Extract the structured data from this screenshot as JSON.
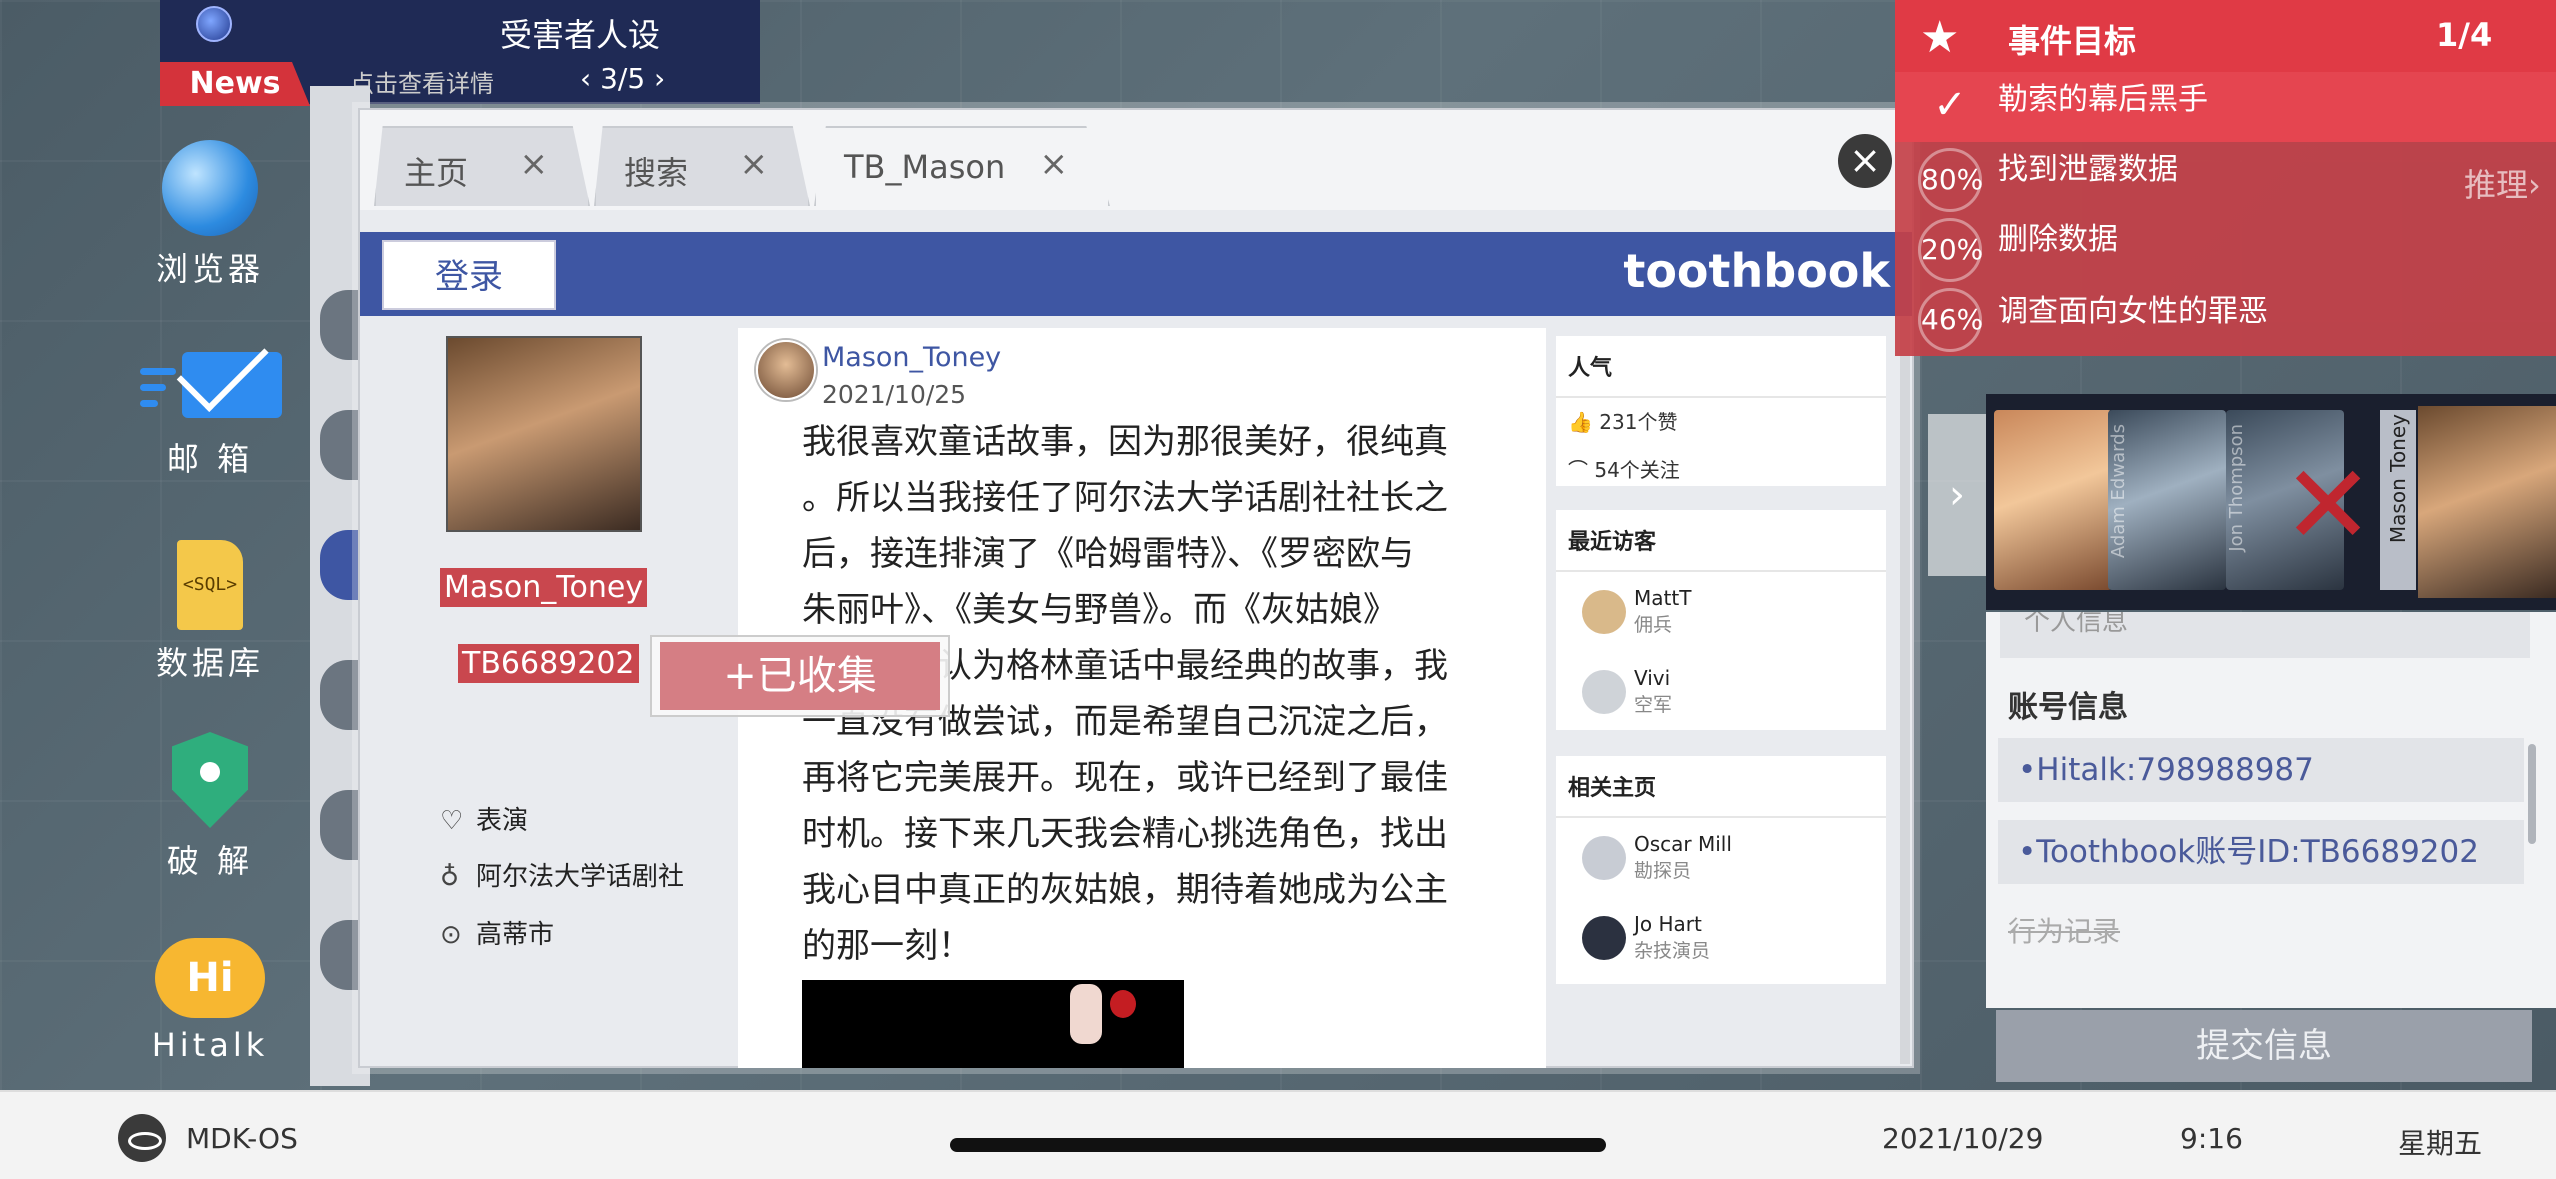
{
  "news": {
    "title": "受害者人设",
    "tag": "News",
    "detail": "点击查看详情",
    "page": "‹  3/5  ›"
  },
  "dock": {
    "browser": "浏览器",
    "mail": "邮 箱",
    "database": "数据库",
    "sql_label": "<SQL>",
    "crack": "破 解",
    "hitalk_icon": "Hi",
    "hitalk": "Hitalk"
  },
  "tabs": [
    {
      "label": "主页",
      "close": "×"
    },
    {
      "label": "搜索",
      "close": "×"
    },
    {
      "label": "TB_Mason",
      "close": "×"
    }
  ],
  "window": {
    "close": "×"
  },
  "site": {
    "login": "登录",
    "logo": "toothbook"
  },
  "profile": {
    "name": "Mason_Toney",
    "id": "TB6689202",
    "interest": "表演",
    "org": "阿尔法大学话剧社",
    "city": "高蒂市",
    "icons": {
      "interest": "heart-icon",
      "org": "medal-icon",
      "city": "location-pin-icon"
    }
  },
  "collect": {
    "label": "+已收集"
  },
  "post": {
    "author": "Mason_Toney",
    "date": "2021/10/25",
    "lines": [
      "我很喜欢童话故事，因为那很美好，很纯真",
      "。所以当我接任了阿尔法大学话剧社社长之",
      "后，接连排演了《哈姆雷特》、《罗密欧与",
      "朱丽叶》、《美女与野兽》。而《灰姑娘》",
      "一直被我认为格林童话中最经典的故事，我",
      "一直没有做尝试，而是希望自己沉淀之后，",
      "再将它完美展开。现在，或许已经到了最佳",
      "时机。接下来几天我会精心挑选角色，找出",
      "我心目中真正的灰姑娘，期待着她成为公主",
      "的那一刻！"
    ]
  },
  "side": {
    "popularity_title": "人气",
    "likes": "231个赞",
    "follows": "54个关注",
    "visitors_title": "最近访客",
    "visitors": [
      {
        "name": "MattT",
        "role": "佣兵"
      },
      {
        "name": "Vivi",
        "role": "空军"
      }
    ],
    "related_title": "相关主页",
    "related": [
      {
        "name": "Oscar Mill",
        "role": "勘探员"
      },
      {
        "name": "Jo Hart",
        "role": "杂技演员"
      }
    ]
  },
  "objectives": {
    "title": "事件目标",
    "count": "1/4",
    "infer": "推理›",
    "items": [
      {
        "mark": "✓",
        "text": "勒索的幕后黑手",
        "done": true
      },
      {
        "mark": "80%",
        "text": "找到泄露数据",
        "done": false
      },
      {
        "mark": "20%",
        "text": "删除数据",
        "done": false
      },
      {
        "mark": "46%",
        "text": "调查面向女性的罪恶",
        "done": false
      }
    ]
  },
  "characters": {
    "arrow": "›",
    "names": [
      "Adam Edwards",
      "Jon Thompson",
      "Mason Toney"
    ],
    "eliminated_mark": "✕"
  },
  "account": {
    "stub": "个人信息",
    "title": "账号信息",
    "items": [
      "•Hitalk:798988987",
      "•Toothbook账号ID:TB6689202"
    ],
    "record": "行为记录",
    "submit": "提交信息"
  },
  "taskbar": {
    "os": "MDK-OS",
    "date": "2021/10/29",
    "time": "9:16",
    "day": "星期五"
  }
}
